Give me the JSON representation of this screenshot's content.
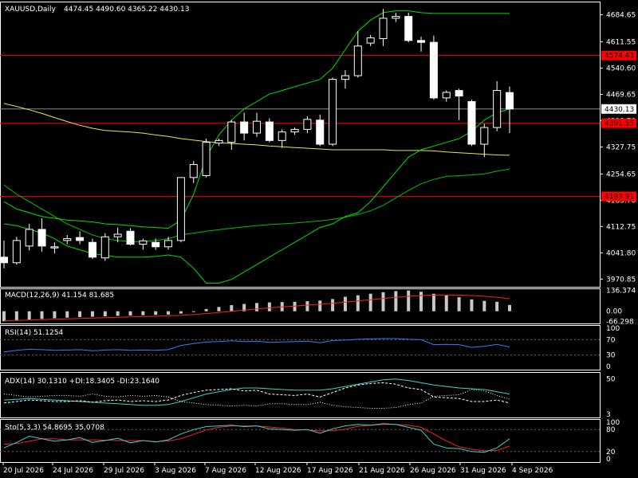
{
  "header": {
    "symbol": "XAUUSD,Daily",
    "ohlc": "4474.45 4490.60 4365.22 4430.13"
  },
  "colors": {
    "background": "#000000",
    "grid": "#ffffff",
    "bull_candle": "#ffffff",
    "bear_candle": "#ffffff",
    "bollinger": "#00e000",
    "ma_slow": "#00c000",
    "ma_yellow": "#e6e64c",
    "red_levels": "#ff0000",
    "macd_hist": "#c8c8c8",
    "macd_signal": "#ff2020",
    "rsi_line": "#2f7fff",
    "adx_line": "#3fd0d0",
    "adx_di": "#ffffff",
    "stoch_main": "#3fd0d0",
    "stoch_signal": "#ff2020"
  },
  "price_axis": {
    "ticks": [
      "4684.65",
      "4611.55",
      "4540.60",
      "4469.65",
      "4398.70",
      "4327.75",
      "4254.65",
      "4183.70",
      "4112.75",
      "4041.80",
      "3970.85"
    ],
    "tick_values": [
      4684.65,
      4611.55,
      4540.6,
      4469.65,
      4398.7,
      4327.75,
      4254.65,
      4183.7,
      4112.75,
      4041.8,
      3970.85
    ],
    "current_price": "4430.13",
    "current_value": 4430.13,
    "levels": [
      {
        "label": "4574.43",
        "value": 4574.43
      },
      {
        "label": "4391.55",
        "value": 4391.55
      },
      {
        "label": "4193.91",
        "value": 4193.91
      }
    ]
  },
  "date_axis": [
    "20 Jul 2026",
    "24 Jul 2026",
    "29 Jul 2026",
    "3 Aug 2026",
    "7 Aug 2026",
    "12 Aug 2026",
    "17 Aug 2026",
    "21 Aug 2026",
    "26 Aug 2026",
    "31 Aug 2026",
    "4 Sep 2026"
  ],
  "chart_data": {
    "type": "candlestick",
    "candles": [
      {
        "o": 4030,
        "h": 4075,
        "l": 4000,
        "c": 4015
      },
      {
        "o": 4015,
        "h": 4085,
        "l": 4010,
        "c": 4075
      },
      {
        "o": 4060,
        "h": 4120,
        "l": 4048,
        "c": 4105
      },
      {
        "o": 4105,
        "h": 4135,
        "l": 4045,
        "c": 4060
      },
      {
        "o": 4055,
        "h": 4070,
        "l": 4040,
        "c": 4058
      },
      {
        "o": 4075,
        "h": 4090,
        "l": 4065,
        "c": 4080
      },
      {
        "o": 4083,
        "h": 4100,
        "l": 4065,
        "c": 4075
      },
      {
        "o": 4070,
        "h": 4080,
        "l": 4025,
        "c": 4030
      },
      {
        "o": 4028,
        "h": 4095,
        "l": 4020,
        "c": 4085
      },
      {
        "o": 4085,
        "h": 4110,
        "l": 4070,
        "c": 4092
      },
      {
        "o": 4100,
        "h": 4108,
        "l": 4062,
        "c": 4065
      },
      {
        "o": 4065,
        "h": 4080,
        "l": 4050,
        "c": 4074
      },
      {
        "o": 4070,
        "h": 4080,
        "l": 4050,
        "c": 4058
      },
      {
        "o": 4058,
        "h": 4085,
        "l": 4050,
        "c": 4075
      },
      {
        "o": 4075,
        "h": 4160,
        "l": 4070,
        "c": 4245
      },
      {
        "o": 4245,
        "h": 4290,
        "l": 4230,
        "c": 4280
      },
      {
        "o": 4250,
        "h": 4350,
        "l": 4245,
        "c": 4340
      },
      {
        "o": 4338,
        "h": 4350,
        "l": 4330,
        "c": 4345
      },
      {
        "o": 4340,
        "h": 4400,
        "l": 4320,
        "c": 4395
      },
      {
        "o": 4395,
        "h": 4420,
        "l": 4345,
        "c": 4365
      },
      {
        "o": 4365,
        "h": 4420,
        "l": 4355,
        "c": 4397
      },
      {
        "o": 4395,
        "h": 4405,
        "l": 4340,
        "c": 4345
      },
      {
        "o": 4345,
        "h": 4375,
        "l": 4325,
        "c": 4368
      },
      {
        "o": 4368,
        "h": 4380,
        "l": 4360,
        "c": 4375
      },
      {
        "o": 4375,
        "h": 4410,
        "l": 4365,
        "c": 4402
      },
      {
        "o": 4400,
        "h": 4415,
        "l": 4330,
        "c": 4335
      },
      {
        "o": 4335,
        "h": 4515,
        "l": 4330,
        "c": 4510
      },
      {
        "o": 4510,
        "h": 4535,
        "l": 4485,
        "c": 4520
      },
      {
        "o": 4520,
        "h": 4640,
        "l": 4515,
        "c": 4600
      },
      {
        "o": 4608,
        "h": 4630,
        "l": 4600,
        "c": 4622
      },
      {
        "o": 4620,
        "h": 4700,
        "l": 4600,
        "c": 4675
      },
      {
        "o": 4675,
        "h": 4690,
        "l": 4665,
        "c": 4680
      },
      {
        "o": 4680,
        "h": 4690,
        "l": 4610,
        "c": 4615
      },
      {
        "o": 4615,
        "h": 4625,
        "l": 4585,
        "c": 4610
      },
      {
        "o": 4610,
        "h": 4628,
        "l": 4455,
        "c": 4460
      },
      {
        "o": 4460,
        "h": 4480,
        "l": 4450,
        "c": 4475
      },
      {
        "o": 4480,
        "h": 4485,
        "l": 4400,
        "c": 4465
      },
      {
        "o": 4450,
        "h": 4455,
        "l": 4330,
        "c": 4335
      },
      {
        "o": 4335,
        "h": 4390,
        "l": 4300,
        "c": 4380
      },
      {
        "o": 4380,
        "h": 4505,
        "l": 4370,
        "c": 4480
      },
      {
        "o": 4474.45,
        "h": 4490.6,
        "l": 4365.22,
        "c": 4430.13
      }
    ],
    "macd": {
      "label": "MACD(12,26,9) 41.154 81.685",
      "ticks": [
        "136.374",
        "0.00",
        "-66.298"
      ],
      "tick_values": [
        136.374,
        0,
        -66.298
      ],
      "hist": [
        -66,
        -60,
        -55,
        -50,
        -46,
        -42,
        -38,
        -36,
        -33,
        -30,
        -28,
        -26,
        -24,
        -22,
        -15,
        0,
        15,
        28,
        40,
        48,
        54,
        58,
        60,
        62,
        66,
        70,
        80,
        95,
        105,
        115,
        125,
        132,
        136,
        128,
        115,
        105,
        92,
        78,
        68,
        62,
        41
      ],
      "signal": [
        -62,
        -60,
        -58,
        -55,
        -52,
        -50,
        -47,
        -45,
        -42,
        -40,
        -37,
        -35,
        -33,
        -30,
        -27,
        -22,
        -15,
        -8,
        0,
        8,
        15,
        22,
        28,
        34,
        40,
        46,
        52,
        60,
        68,
        76,
        84,
        91,
        98,
        103,
        106,
        107,
        106,
        103,
        98,
        92,
        82
      ]
    },
    "rsi": {
      "label": "RSI(14) 51.1254",
      "ticks": [
        "100",
        "70",
        "30",
        "0"
      ],
      "tick_values": [
        100,
        70,
        30,
        0
      ],
      "values": [
        38,
        42,
        45,
        44,
        42,
        43,
        44,
        41,
        43,
        44,
        42,
        43,
        42,
        44,
        55,
        60,
        64,
        65,
        67,
        65,
        66,
        63,
        64,
        65,
        66,
        62,
        68,
        69,
        71,
        72,
        73,
        73,
        71,
        70,
        57,
        58,
        57,
        50,
        53,
        58,
        51
      ]
    },
    "adx": {
      "label": "ADX(14) 30.1310 +DI:18.3405 -DI:23.1640",
      "ticks": [
        "50",
        "3"
      ],
      "tick_values": [
        50,
        3
      ],
      "adx": [
        22,
        23,
        24,
        23,
        22,
        21,
        20,
        19,
        18,
        17,
        16,
        15,
        15,
        16,
        20,
        25,
        30,
        33,
        36,
        38,
        38,
        37,
        36,
        35,
        35,
        35,
        37,
        40,
        43,
        46,
        49,
        50,
        48,
        45,
        42,
        40,
        38,
        37,
        36,
        33,
        30
      ],
      "plus_di": [
        18,
        20,
        22,
        21,
        20,
        20,
        21,
        19,
        21,
        22,
        20,
        21,
        20,
        22,
        28,
        32,
        35,
        36,
        37,
        34,
        35,
        30,
        29,
        28,
        30,
        26,
        32,
        38,
        42,
        44,
        45,
        43,
        38,
        36,
        26,
        25,
        24,
        20,
        20,
        22,
        18
      ],
      "minus_di": [
        30,
        28,
        26,
        27,
        28,
        28,
        27,
        30,
        27,
        26,
        28,
        27,
        28,
        26,
        20,
        18,
        16,
        15,
        14,
        15,
        14,
        17,
        17,
        16,
        16,
        19,
        15,
        13,
        12,
        11,
        11,
        12,
        16,
        18,
        27,
        28,
        29,
        36,
        34,
        28,
        23
      ]
    },
    "stoch": {
      "label": "Sto(5,3,3) 54.8695 35.0708",
      "ticks": [
        "100",
        "80",
        "20",
        "0"
      ],
      "tick_values": [
        100,
        80,
        20,
        0
      ],
      "main": [
        30,
        45,
        62,
        55,
        48,
        52,
        58,
        45,
        50,
        56,
        44,
        50,
        46,
        52,
        68,
        80,
        88,
        90,
        92,
        88,
        90,
        82,
        80,
        78,
        80,
        70,
        82,
        90,
        94,
        92,
        96,
        94,
        86,
        78,
        40,
        30,
        28,
        20,
        18,
        30,
        55
      ],
      "signal": [
        40,
        42,
        48,
        55,
        55,
        52,
        52,
        52,
        51,
        50,
        50,
        50,
        47,
        49,
        55,
        67,
        79,
        86,
        90,
        90,
        90,
        87,
        84,
        80,
        79,
        76,
        77,
        81,
        89,
        92,
        94,
        94,
        92,
        86,
        68,
        49,
        33,
        26,
        22,
        23,
        35
      ]
    },
    "bollinger_upper": [
      4180,
      4160,
      4150,
      4140,
      4135,
      4130,
      4128,
      4125,
      4120,
      4118,
      4115,
      4112,
      4110,
      4108,
      4130,
      4200,
      4300,
      4360,
      4400,
      4430,
      4450,
      4470,
      4480,
      4490,
      4500,
      4510,
      4540,
      4590,
      4640,
      4670,
      4690,
      4695,
      4695,
      4690,
      4688,
      4688,
      4688,
      4688,
      4688,
      4688,
      4688
    ],
    "bollinger_middle": [
      4150,
      4140,
      4130,
      4120,
      4110,
      4100,
      4092,
      4085,
      4080,
      4078,
      4076,
      4075,
      4073,
      4072,
      4080,
      4100,
      4130,
      4160,
      4190,
      4220,
      4245,
      4265,
      4285,
      4300,
      4315,
      4330,
      4350,
      4380,
      4410,
      4440,
      4465,
      4480,
      4485,
      4480,
      4470,
      4465,
      4460,
      4460,
      4460,
      4462,
      4463
    ],
    "bollinger_lower": [
      4120,
      4115,
      4105,
      4095,
      4080,
      4060,
      4050,
      4040,
      4035,
      4030,
      4030,
      4030,
      4032,
      4036,
      4030,
      4000,
      3960,
      3960,
      3970,
      3990,
      4010,
      4030,
      4050,
      4070,
      4090,
      4110,
      4120,
      4140,
      4150,
      4180,
      4220,
      4260,
      4300,
      4320,
      4330,
      4340,
      4350,
      4370,
      4400,
      4420,
      4430
    ],
    "ma_slow": [
      4225,
      4200,
      4180,
      4160,
      4140,
      4120,
      4105,
      4090,
      4080,
      4075,
      4072,
      4072,
      4075,
      4080,
      4090,
      4095,
      4100,
      4104,
      4108,
      4112,
      4115,
      4118,
      4120,
      4122,
      4125,
      4128,
      4132,
      4138,
      4145,
      4155,
      4170,
      4190,
      4210,
      4228,
      4240,
      4248,
      4250,
      4252,
      4255,
      4262,
      4268
    ],
    "ma_yellow": [
      4445,
      4437,
      4428,
      4418,
      4407,
      4396,
      4386,
      4378,
      4372,
      4370,
      4368,
      4365,
      4360,
      4356,
      4350,
      4346,
      4342,
      4339,
      4337,
      4335,
      4333,
      4330,
      4328,
      4326,
      4324,
      4322,
      4320,
      4320,
      4320,
      4320,
      4320,
      4318,
      4318,
      4318,
      4317,
      4314,
      4312,
      4310,
      4308,
      4306,
      4305
    ]
  }
}
